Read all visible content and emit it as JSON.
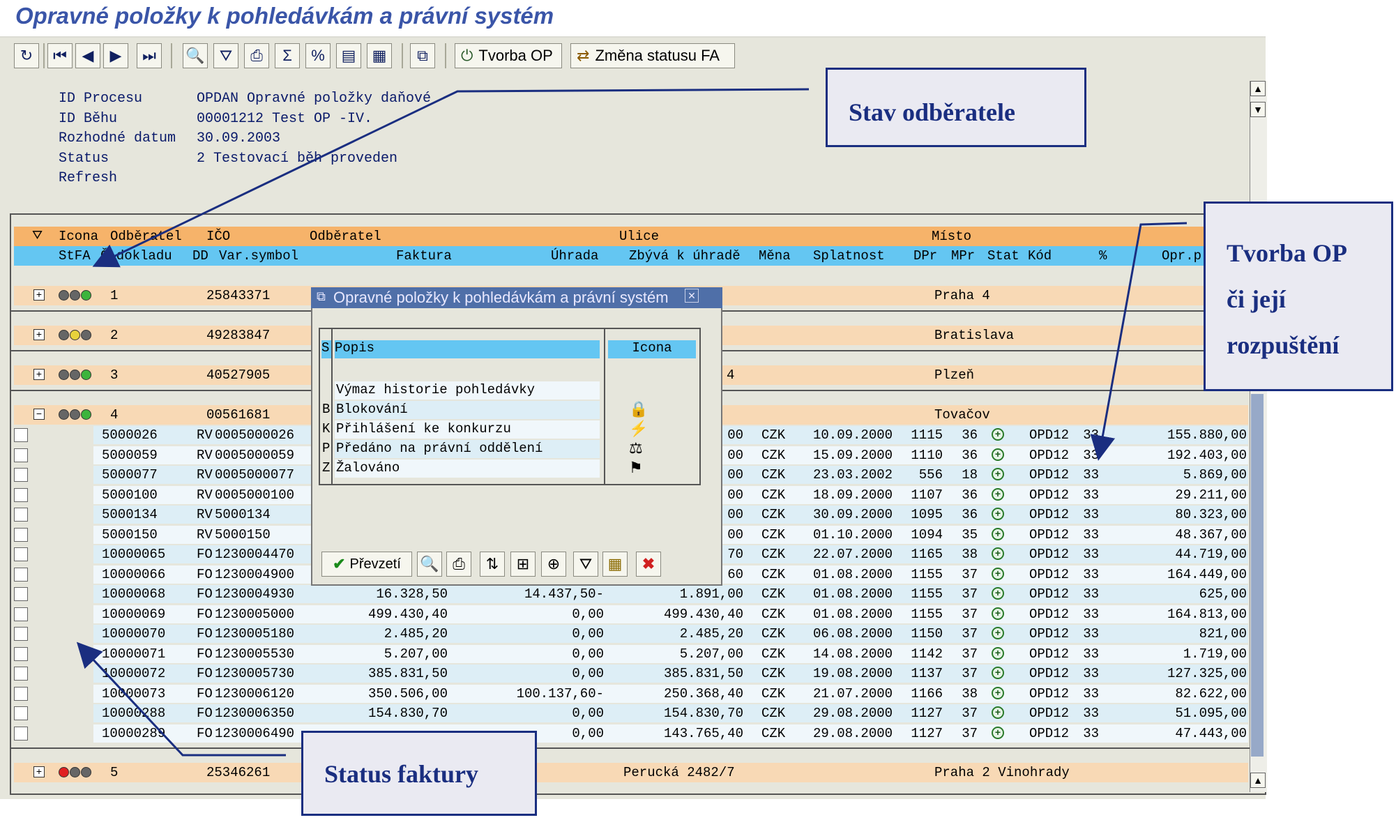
{
  "window": {
    "title": "Opravné položky k pohledávkám a právní systém"
  },
  "toolbar": {
    "buttons": [
      {
        "icon": "refresh-icon"
      },
      {
        "icon": "first-page-icon"
      },
      {
        "icon": "previous-icon"
      },
      {
        "icon": "next-icon"
      },
      {
        "icon": "last-page-icon"
      },
      {
        "icon": "details-icon"
      },
      {
        "icon": "filter-icon"
      },
      {
        "icon": "print-icon"
      },
      {
        "icon": "sum-icon"
      },
      {
        "icon": "subtotal-icon"
      },
      {
        "icon": "export-icon"
      },
      {
        "icon": "layout-icon"
      },
      {
        "icon": "copy-icon"
      }
    ],
    "tvorba_op_label": "Tvorba OP",
    "zmena_statusu_label": "Změna statusu FA"
  },
  "header_info": {
    "rows": [
      {
        "label": "ID Procesu",
        "value": "OPDAN Opravné položky daňové"
      },
      {
        "label": "ID Běhu",
        "value": "00001212 Test OP -IV."
      },
      {
        "label": "Rozhodné datum",
        "value": "30.09.2003"
      },
      {
        "label": "Status",
        "value": "2 Testovací běh proveden"
      },
      {
        "label": "Refresh",
        "value": ""
      }
    ]
  },
  "columns": {
    "row1": [
      "Icona",
      "Odběratel",
      "IČO",
      "Odběratel",
      "Ulice",
      "Místo"
    ],
    "row2": [
      "StFA",
      "Č.dokladu",
      "DD",
      "Var.symbol",
      "Faktura",
      "Úhrada",
      "Zbývá k úhradě",
      "Měna",
      "Splatnost",
      "DPr",
      "MPr",
      "Stat",
      "Kód",
      "%",
      "Opr.p"
    ]
  },
  "groups": [
    {
      "num": "1",
      "ico": "25843371",
      "street": "",
      "city": "Praha 4",
      "lights": [
        "#666",
        "#666",
        "#3cb43c"
      ],
      "expanded": false
    },
    {
      "num": "2",
      "ico": "49283847",
      "street": "",
      "city": "Bratislava",
      "lights": [
        "#666",
        "#e8d23c",
        "#666"
      ],
      "expanded": false
    },
    {
      "num": "3",
      "ico": "40527905",
      "street": "4",
      "city": "Plzeň",
      "lights": [
        "#666",
        "#666",
        "#3cb43c"
      ],
      "expanded": false
    },
    {
      "num": "4",
      "ico": "00561681",
      "street": "",
      "city": "Tovačov",
      "lights": [
        "#666",
        "#666",
        "#3cb43c"
      ],
      "expanded": true
    },
    {
      "num": "5",
      "ico": "25346261",
      "street": "Perucká 2482/7",
      "city": "Praha 2 Vinohrady",
      "lights": [
        "#e02020",
        "#666",
        "#666"
      ],
      "expanded": false
    }
  ],
  "detail_rows": [
    {
      "doc": "5000026",
      "dd": "RV",
      "vs": "0005000026",
      "faktura": "",
      "uhrada": "",
      "zbyva": "00",
      "mena": "CZK",
      "splatnost": "10.09.2000",
      "dpr": "1115",
      "mpr": "36",
      "kod": "OPD12",
      "pct": "33",
      "opr": "155.880,00"
    },
    {
      "doc": "5000059",
      "dd": "RV",
      "vs": "0005000059",
      "faktura": "",
      "uhrada": "",
      "zbyva": "00",
      "mena": "CZK",
      "splatnost": "15.09.2000",
      "dpr": "1110",
      "mpr": "36",
      "kod": "OPD12",
      "pct": "33",
      "opr": "192.403,00"
    },
    {
      "doc": "5000077",
      "dd": "RV",
      "vs": "0005000077",
      "faktura": "",
      "uhrada": "",
      "zbyva": "00",
      "mena": "CZK",
      "splatnost": "23.03.2002",
      "dpr": "556",
      "mpr": "18",
      "kod": "OPD12",
      "pct": "33",
      "opr": "5.869,00"
    },
    {
      "doc": "5000100",
      "dd": "RV",
      "vs": "0005000100",
      "faktura": "",
      "uhrada": "",
      "zbyva": "00",
      "mena": "CZK",
      "splatnost": "18.09.2000",
      "dpr": "1107",
      "mpr": "36",
      "kod": "OPD12",
      "pct": "33",
      "opr": "29.211,00"
    },
    {
      "doc": "5000134",
      "dd": "RV",
      "vs": "5000134",
      "faktura": "",
      "uhrada": "",
      "zbyva": "00",
      "mena": "CZK",
      "splatnost": "30.09.2000",
      "dpr": "1095",
      "mpr": "36",
      "kod": "OPD12",
      "pct": "33",
      "opr": "80.323,00"
    },
    {
      "doc": "5000150",
      "dd": "RV",
      "vs": "5000150",
      "faktura": "",
      "uhrada": "",
      "zbyva": "00",
      "mena": "CZK",
      "splatnost": "01.10.2000",
      "dpr": "1094",
      "mpr": "35",
      "kod": "OPD12",
      "pct": "33",
      "opr": "48.367,00"
    },
    {
      "doc": "10000065",
      "dd": "FO",
      "vs": "1230004470",
      "faktura": "",
      "uhrada": "",
      "zbyva": "70",
      "mena": "CZK",
      "splatnost": "22.07.2000",
      "dpr": "1165",
      "mpr": "38",
      "kod": "OPD12",
      "pct": "33",
      "opr": "44.719,00"
    },
    {
      "doc": "10000066",
      "dd": "FO",
      "vs": "1230004900",
      "faktura": "",
      "uhrada": "",
      "zbyva": "60",
      "mena": "CZK",
      "splatnost": "01.08.2000",
      "dpr": "1155",
      "mpr": "37",
      "kod": "OPD12",
      "pct": "33",
      "opr": "164.449,00"
    },
    {
      "doc": "10000068",
      "dd": "FO",
      "vs": "1230004930",
      "faktura": "16.328,50",
      "uhrada": "14.437,50-",
      "zbyva": "1.891,00",
      "mena": "CZK",
      "splatnost": "01.08.2000",
      "dpr": "1155",
      "mpr": "37",
      "kod": "OPD12",
      "pct": "33",
      "opr": "625,00"
    },
    {
      "doc": "10000069",
      "dd": "FO",
      "vs": "1230005000",
      "faktura": "499.430,40",
      "uhrada": "0,00",
      "zbyva": "499.430,40",
      "mena": "CZK",
      "splatnost": "01.08.2000",
      "dpr": "1155",
      "mpr": "37",
      "kod": "OPD12",
      "pct": "33",
      "opr": "164.813,00"
    },
    {
      "doc": "10000070",
      "dd": "FO",
      "vs": "1230005180",
      "faktura": "2.485,20",
      "uhrada": "0,00",
      "zbyva": "2.485,20",
      "mena": "CZK",
      "splatnost": "06.08.2000",
      "dpr": "1150",
      "mpr": "37",
      "kod": "OPD12",
      "pct": "33",
      "opr": "821,00"
    },
    {
      "doc": "10000071",
      "dd": "FO",
      "vs": "1230005530",
      "faktura": "5.207,00",
      "uhrada": "0,00",
      "zbyva": "5.207,00",
      "mena": "CZK",
      "splatnost": "14.08.2000",
      "dpr": "1142",
      "mpr": "37",
      "kod": "OPD12",
      "pct": "33",
      "opr": "1.719,00"
    },
    {
      "doc": "10000072",
      "dd": "FO",
      "vs": "1230005730",
      "faktura": "385.831,50",
      "uhrada": "0,00",
      "zbyva": "385.831,50",
      "mena": "CZK",
      "splatnost": "19.08.2000",
      "dpr": "1137",
      "mpr": "37",
      "kod": "OPD12",
      "pct": "33",
      "opr": "127.325,00"
    },
    {
      "doc": "10000073",
      "dd": "FO",
      "vs": "1230006120",
      "faktura": "350.506,00",
      "uhrada": "100.137,60-",
      "zbyva": "250.368,40",
      "mena": "CZK",
      "splatnost": "21.07.2000",
      "dpr": "1166",
      "mpr": "38",
      "kod": "OPD12",
      "pct": "33",
      "opr": "82.622,00"
    },
    {
      "doc": "10000288",
      "dd": "FO",
      "vs": "1230006350",
      "faktura": "154.830,70",
      "uhrada": "0,00",
      "zbyva": "154.830,70",
      "mena": "CZK",
      "splatnost": "29.08.2000",
      "dpr": "1127",
      "mpr": "37",
      "kod": "OPD12",
      "pct": "33",
      "opr": "51.095,00"
    },
    {
      "doc": "10000289",
      "dd": "FO",
      "vs": "1230006490",
      "faktura": "",
      "uhrada": "0,00",
      "zbyva": "143.765,40",
      "mena": "CZK",
      "splatnost": "29.08.2000",
      "dpr": "1127",
      "mpr": "37",
      "kod": "OPD12",
      "pct": "33",
      "opr": "47.443,00"
    }
  ],
  "popup": {
    "title": "Opravné položky k pohledávkám a právní systém",
    "col_s": "S",
    "col_popis": "Popis",
    "col_icona": "Icona",
    "items": [
      {
        "s": "",
        "popis": "Výmaz historie pohledávky",
        "icon": ""
      },
      {
        "s": "B",
        "popis": "Blokování",
        "icon": "lock-icon"
      },
      {
        "s": "K",
        "popis": "Přihlášení ke konkurzu",
        "icon": "bankruptcy-icon"
      },
      {
        "s": "P",
        "popis": "Předáno na právní oddělení",
        "icon": "legal-dept-icon"
      },
      {
        "s": "Z",
        "popis": "Žalováno",
        "icon": "lawsuit-icon"
      }
    ],
    "confirm_label": "Převzetí"
  },
  "callouts": {
    "stav": "Stav odběratele",
    "tvorba_line1": "Tvorba OP",
    "tvorba_line2": "či její",
    "tvorba_line3": "rozpuštění",
    "status": "Status faktury"
  },
  "colors": {
    "title": "#3a55a8",
    "header_orange": "#f6b36a",
    "header_blue": "#64c6f2",
    "callout": "#1a2e80"
  }
}
